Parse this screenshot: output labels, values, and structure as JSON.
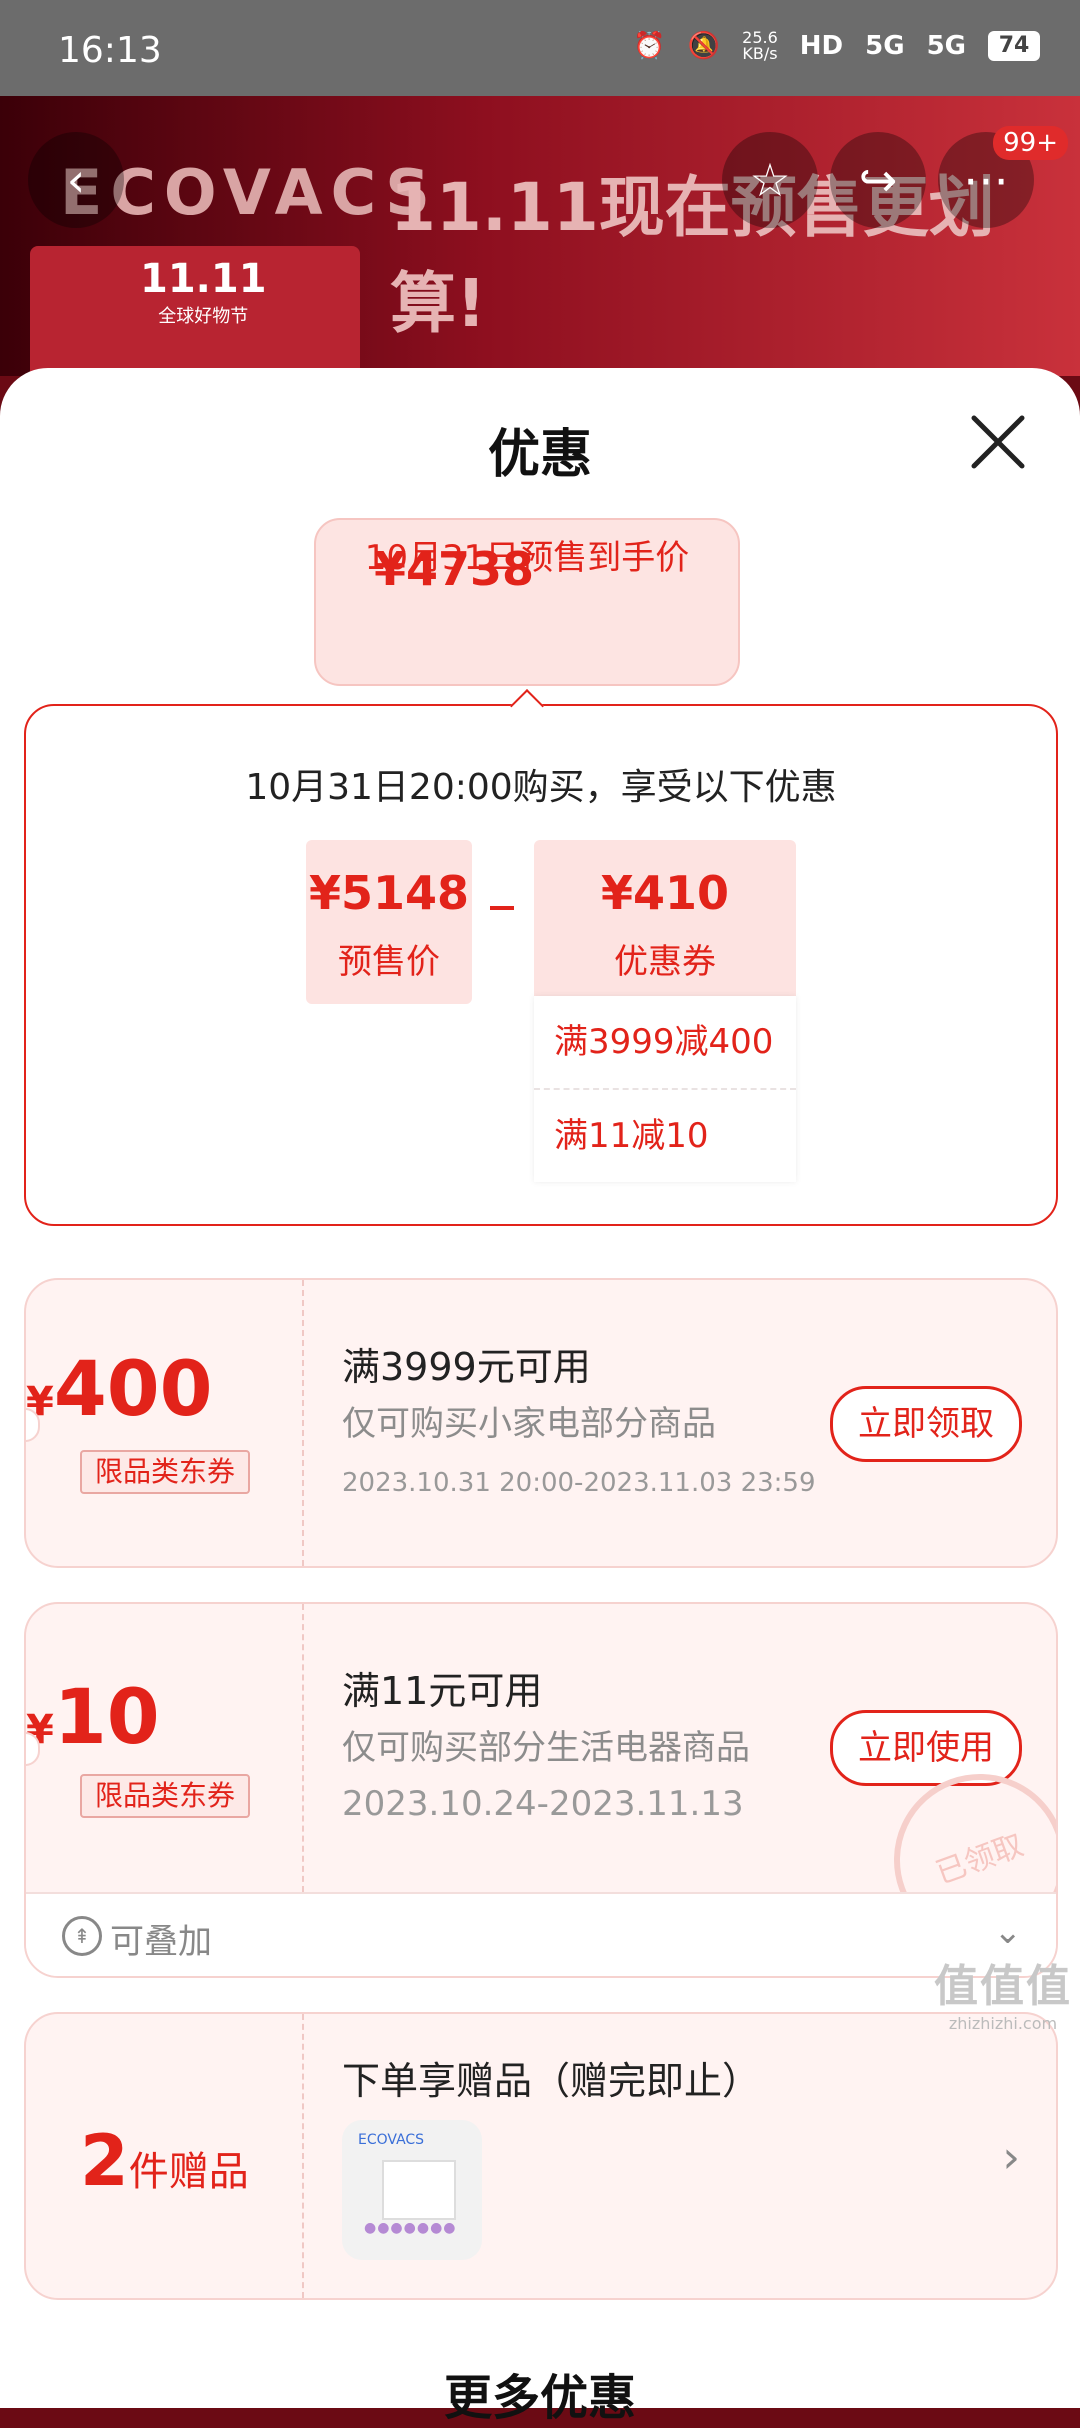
{
  "status": {
    "time": "16:13",
    "net_speed": "25.6",
    "net_unit": "KB/s",
    "hd": "HD",
    "sim1": "5G",
    "sim2": "5G",
    "battery": "74"
  },
  "banner": {
    "brand": "ECOVACS",
    "slogan": "11.11现在预售更划算!",
    "fest_big": "11.11",
    "fest_small": "全球好物节",
    "cart_badge": "99+"
  },
  "sheet": {
    "title": "优惠"
  },
  "bubble": {
    "amount": "¥4738",
    "desc": "10月31日预售到手价"
  },
  "calc": {
    "headline": "10月31日20:00购买，享受以下优惠",
    "presale": {
      "value": "¥5148",
      "label": "预售价"
    },
    "coupon": {
      "value": "¥410",
      "label": "优惠券"
    },
    "coupons": [
      "满3999减400",
      "满11减10"
    ]
  },
  "coupon1": {
    "currency": "¥",
    "amount": "400",
    "tag": "限品类东券",
    "title": "满3999元可用",
    "subtitle": "仅可购买小家电部分商品",
    "date": "2023.10.31 20:00-2023.11.03 23:59",
    "action": "立即领取"
  },
  "coupon2": {
    "currency": "¥",
    "amount": "10",
    "tag": "限品类东券",
    "title": "满11元可用",
    "subtitle": "仅可购买部分生活电器商品",
    "date": "2023.10.24-2023.11.13",
    "action": "立即使用",
    "stamp": "已领取",
    "stack_label": "可叠加"
  },
  "gift": {
    "count": "2",
    "count_label": "件赠品",
    "title": "下单享赠品（赠完即止）",
    "thumb_brand": "ECOVACS"
  },
  "more": {
    "title": "更多优惠"
  },
  "watermark": {
    "logo": "值值值",
    "site": "zhizhizhi.com"
  }
}
